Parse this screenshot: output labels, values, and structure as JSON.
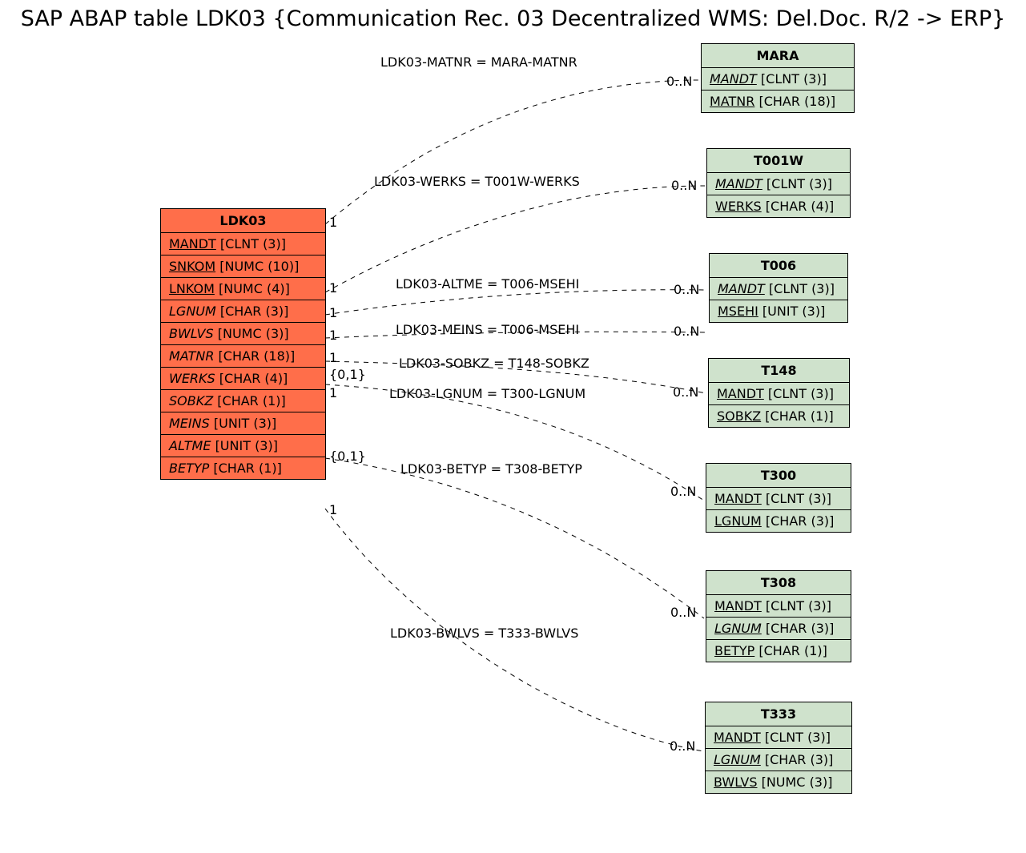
{
  "title": "SAP ABAP table LDK03 {Communication Rec. 03 Decentralized WMS: Del.Doc. R/2 -> ERP}",
  "main": {
    "name": "LDK03",
    "fields": [
      {
        "name": "MANDT",
        "type": "[CLNT (3)]",
        "underline": true,
        "italic": false
      },
      {
        "name": "SNKOM",
        "type": "[NUMC (10)]",
        "underline": true,
        "italic": false
      },
      {
        "name": "LNKOM",
        "type": "[NUMC (4)]",
        "underline": true,
        "italic": false
      },
      {
        "name": "LGNUM",
        "type": "[CHAR (3)]",
        "underline": false,
        "italic": true
      },
      {
        "name": "BWLVS",
        "type": "[NUMC (3)]",
        "underline": false,
        "italic": true
      },
      {
        "name": "MATNR",
        "type": "[CHAR (18)]",
        "underline": false,
        "italic": true
      },
      {
        "name": "WERKS",
        "type": "[CHAR (4)]",
        "underline": false,
        "italic": true
      },
      {
        "name": "SOBKZ",
        "type": "[CHAR (1)]",
        "underline": false,
        "italic": true
      },
      {
        "name": "MEINS",
        "type": "[UNIT (3)]",
        "underline": false,
        "italic": true
      },
      {
        "name": "ALTME",
        "type": "[UNIT (3)]",
        "underline": false,
        "italic": true
      },
      {
        "name": "BETYP",
        "type": "[CHAR (1)]",
        "underline": false,
        "italic": true
      }
    ]
  },
  "refs": [
    {
      "name": "MARA",
      "fields": [
        {
          "name": "MANDT",
          "type": "[CLNT (3)]",
          "underline": true,
          "italic": true
        },
        {
          "name": "MATNR",
          "type": "[CHAR (18)]",
          "underline": true,
          "italic": false
        }
      ]
    },
    {
      "name": "T001W",
      "fields": [
        {
          "name": "MANDT",
          "type": "[CLNT (3)]",
          "underline": true,
          "italic": true
        },
        {
          "name": "WERKS",
          "type": "[CHAR (4)]",
          "underline": true,
          "italic": false
        }
      ]
    },
    {
      "name": "T006",
      "fields": [
        {
          "name": "MANDT",
          "type": "[CLNT (3)]",
          "underline": true,
          "italic": true
        },
        {
          "name": "MSEHI",
          "type": "[UNIT (3)]",
          "underline": true,
          "italic": false
        }
      ]
    },
    {
      "name": "T148",
      "fields": [
        {
          "name": "MANDT",
          "type": "[CLNT (3)]",
          "underline": true,
          "italic": false
        },
        {
          "name": "SOBKZ",
          "type": "[CHAR (1)]",
          "underline": true,
          "italic": false
        }
      ]
    },
    {
      "name": "T300",
      "fields": [
        {
          "name": "MANDT",
          "type": "[CLNT (3)]",
          "underline": true,
          "italic": false
        },
        {
          "name": "LGNUM",
          "type": "[CHAR (3)]",
          "underline": true,
          "italic": false
        }
      ]
    },
    {
      "name": "T308",
      "fields": [
        {
          "name": "MANDT",
          "type": "[CLNT (3)]",
          "underline": true,
          "italic": false
        },
        {
          "name": "LGNUM",
          "type": "[CHAR (3)]",
          "underline": true,
          "italic": true
        },
        {
          "name": "BETYP",
          "type": "[CHAR (1)]",
          "underline": true,
          "italic": false
        }
      ]
    },
    {
      "name": "T333",
      "fields": [
        {
          "name": "MANDT",
          "type": "[CLNT (3)]",
          "underline": true,
          "italic": false
        },
        {
          "name": "LGNUM",
          "type": "[CHAR (3)]",
          "underline": true,
          "italic": true
        },
        {
          "name": "BWLVS",
          "type": "[NUMC (3)]",
          "underline": true,
          "italic": false
        }
      ]
    }
  ],
  "edges": [
    {
      "label": "LDK03-MATNR = MARA-MATNR",
      "left_card": "1",
      "right_card": "0..N"
    },
    {
      "label": "LDK03-WERKS = T001W-WERKS",
      "left_card": "1",
      "right_card": "0..N"
    },
    {
      "label": "LDK03-ALTME = T006-MSEHI",
      "left_card": "1",
      "right_card": "0..N"
    },
    {
      "label": "LDK03-MEINS = T006-MSEHI",
      "left_card": "1",
      "right_card": "0..N"
    },
    {
      "label": "LDK03-SOBKZ = T148-SOBKZ",
      "left_card": "1",
      "right_card": ""
    },
    {
      "label": "LDK03-LGNUM = T300-LGNUM",
      "left_card": "{0,1}",
      "right_card": "0..N"
    },
    {
      "label": "LDK03-BETYP = T308-BETYP",
      "left_card": "1",
      "right_card": "0..N"
    },
    {
      "label": "LDK03-BWLVS = T333-BWLVS",
      "left_card": "{0,1}",
      "right_card": "0..N"
    },
    {
      "label": "",
      "left_card": "1",
      "right_card": ""
    }
  ]
}
